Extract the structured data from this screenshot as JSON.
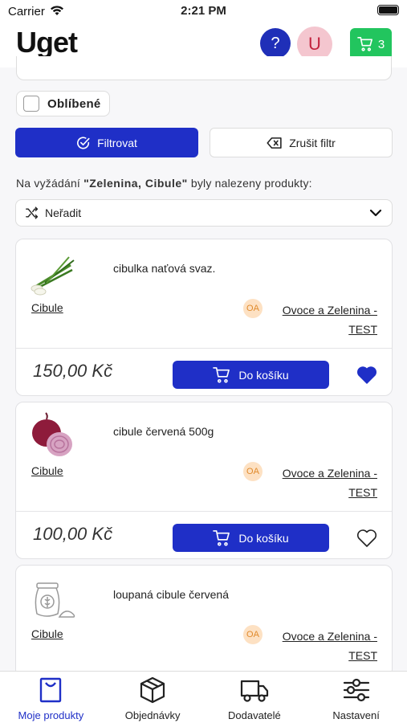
{
  "status_bar": {
    "carrier": "Carrier",
    "time": "2:21 PM"
  },
  "header": {
    "logo": "Uget",
    "help_label": "?",
    "user_initial": "U",
    "cart_count": "3"
  },
  "filters": {
    "favorites_label": "Oblíbené",
    "filter_button": "Filtrovat",
    "clear_button": "Zrušit filtr"
  },
  "results": {
    "prefix": "Na vyžádání ",
    "query": "\"Zelenina, Cibule\"",
    "suffix": " byly nalezeny produkty:"
  },
  "sort": {
    "label": "Neřadit"
  },
  "products": [
    {
      "name": "cibulka naťová svaz.",
      "category": "Cibule",
      "supplier_initials": "OA",
      "supplier_line1": "Ovoce a Zelenina -",
      "supplier_line2": "TEST",
      "price": "150,00 Kč",
      "add_label": "Do košíku",
      "favorite": true
    },
    {
      "name": "cibule červená 500g",
      "category": "Cibule",
      "supplier_initials": "OA",
      "supplier_line1": "Ovoce a Zelenina -",
      "supplier_line2": "TEST",
      "price": "100,00 Kč",
      "add_label": "Do košíku",
      "favorite": false
    },
    {
      "name": "loupaná cibule červená",
      "category": "Cibule",
      "supplier_initials": "OA",
      "supplier_line1": "Ovoce a Zelenina -",
      "supplier_line2": "TEST"
    }
  ],
  "tabbar": [
    {
      "label": "Moje produkty",
      "icon": "shopping-bag-icon",
      "active": true
    },
    {
      "label": "Objednávky",
      "icon": "box-icon",
      "active": false
    },
    {
      "label": "Dodavatelé",
      "icon": "truck-icon",
      "active": false
    },
    {
      "label": "Nastavení",
      "icon": "sliders-icon",
      "active": false
    }
  ],
  "colors": {
    "primary": "#1f2fc7",
    "cart_green": "#22c55e",
    "avatar_pink": "#f4c6cf",
    "supplier_badge": "#fde1c3"
  }
}
